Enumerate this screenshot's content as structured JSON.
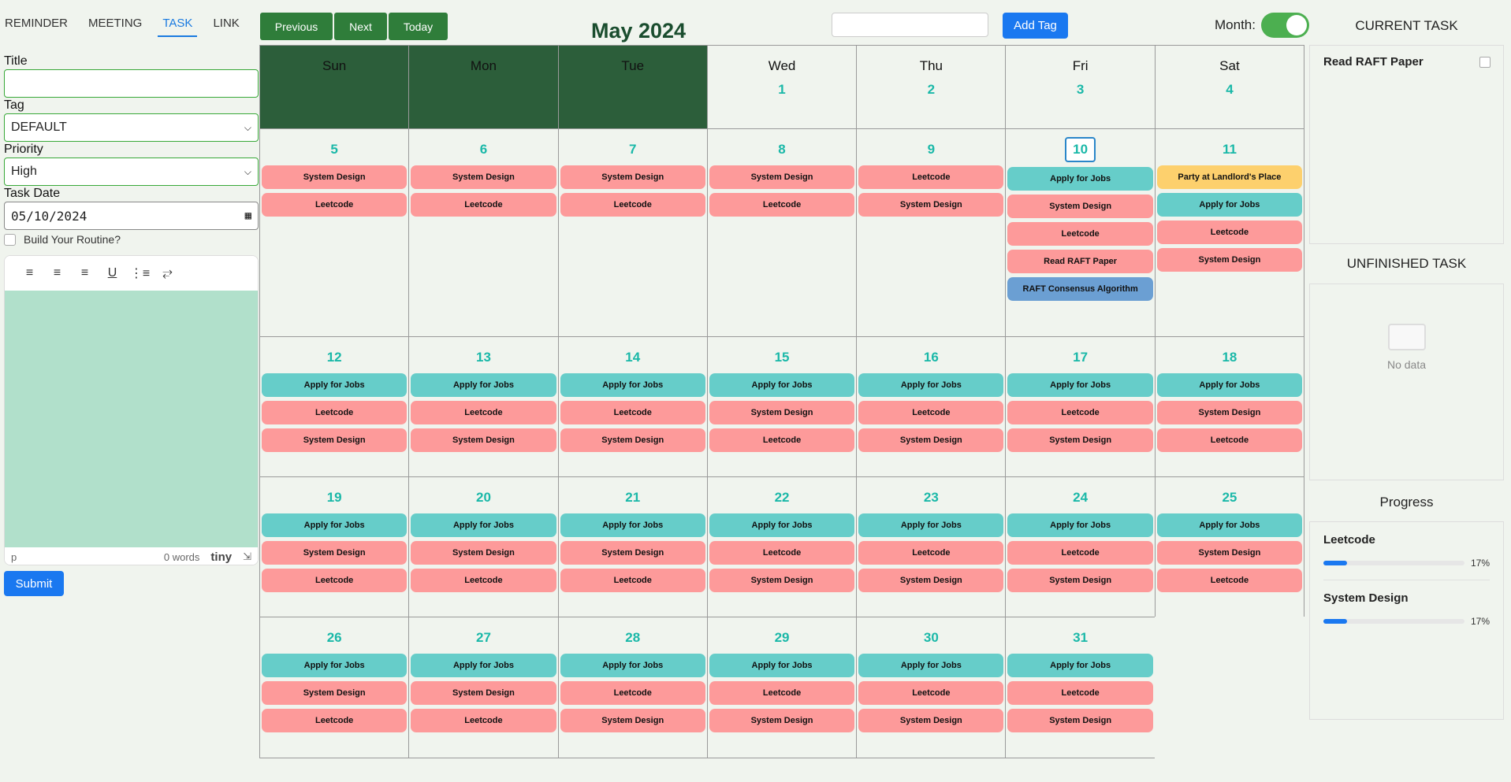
{
  "tabs": [
    "REMINDER",
    "MEETING",
    "TASK",
    "LINK"
  ],
  "active_tab": "TASK",
  "form": {
    "title_label": "Title",
    "title_value": "",
    "tag_label": "Tag",
    "tag_value": "DEFAULT",
    "priority_label": "Priority",
    "priority_value": "High",
    "date_label": "Task Date",
    "date_value": "05/10/2024",
    "routine_label": "Build Your Routine?",
    "editor_status_left": "p",
    "editor_words": "0 words",
    "editor_brand": "tiny",
    "submit_label": "Submit"
  },
  "toolbar": {
    "previous": "Previous",
    "next": "Next",
    "today": "Today",
    "month_title": "May 2024",
    "tag_input_value": "",
    "add_tag": "Add Tag",
    "month_toggle_label": "Month:"
  },
  "calendar": {
    "weekdays": [
      "Sun",
      "Mon",
      "Tue",
      "Wed",
      "Thu",
      "Fri",
      "Sat"
    ],
    "today": "10",
    "weeks": [
      [
        {
          "day": "",
          "events": []
        },
        {
          "day": "",
          "events": []
        },
        {
          "day": "",
          "events": []
        },
        {
          "day": "1",
          "events": []
        },
        {
          "day": "2",
          "events": []
        },
        {
          "day": "3",
          "events": []
        },
        {
          "day": "4",
          "events": []
        }
      ],
      [
        {
          "day": "5",
          "events": [
            [
              "System Design",
              "pink"
            ],
            [
              "Leetcode",
              "pink"
            ]
          ]
        },
        {
          "day": "6",
          "events": [
            [
              "System Design",
              "pink"
            ],
            [
              "Leetcode",
              "pink"
            ]
          ]
        },
        {
          "day": "7",
          "events": [
            [
              "System Design",
              "pink"
            ],
            [
              "Leetcode",
              "pink"
            ]
          ]
        },
        {
          "day": "8",
          "events": [
            [
              "System Design",
              "pink"
            ],
            [
              "Leetcode",
              "pink"
            ]
          ]
        },
        {
          "day": "9",
          "events": [
            [
              "Leetcode",
              "pink"
            ],
            [
              "System Design",
              "pink"
            ]
          ]
        },
        {
          "day": "10",
          "events": [
            [
              "Apply for Jobs",
              "teal"
            ],
            [
              "System Design",
              "pink"
            ],
            [
              "Leetcode",
              "pink"
            ],
            [
              "Read RAFT Paper",
              "pink"
            ],
            [
              "RAFT Consensus Algorithm",
              "blue"
            ]
          ]
        },
        {
          "day": "11",
          "events": [
            [
              "Party at Landlord's Place",
              "yellow"
            ],
            [
              "Apply for Jobs",
              "teal"
            ],
            [
              "Leetcode",
              "pink"
            ],
            [
              "System Design",
              "pink"
            ]
          ]
        }
      ],
      [
        {
          "day": "12",
          "events": [
            [
              "Apply for Jobs",
              "teal"
            ],
            [
              "Leetcode",
              "pink"
            ],
            [
              "System Design",
              "pink"
            ]
          ]
        },
        {
          "day": "13",
          "events": [
            [
              "Apply for Jobs",
              "teal"
            ],
            [
              "Leetcode",
              "pink"
            ],
            [
              "System Design",
              "pink"
            ]
          ]
        },
        {
          "day": "14",
          "events": [
            [
              "Apply for Jobs",
              "teal"
            ],
            [
              "Leetcode",
              "pink"
            ],
            [
              "System Design",
              "pink"
            ]
          ]
        },
        {
          "day": "15",
          "events": [
            [
              "Apply for Jobs",
              "teal"
            ],
            [
              "System Design",
              "pink"
            ],
            [
              "Leetcode",
              "pink"
            ]
          ]
        },
        {
          "day": "16",
          "events": [
            [
              "Apply for Jobs",
              "teal"
            ],
            [
              "Leetcode",
              "pink"
            ],
            [
              "System Design",
              "pink"
            ]
          ]
        },
        {
          "day": "17",
          "events": [
            [
              "Apply for Jobs",
              "teal"
            ],
            [
              "Leetcode",
              "pink"
            ],
            [
              "System Design",
              "pink"
            ]
          ]
        },
        {
          "day": "18",
          "events": [
            [
              "Apply for Jobs",
              "teal"
            ],
            [
              "System Design",
              "pink"
            ],
            [
              "Leetcode",
              "pink"
            ]
          ]
        }
      ],
      [
        {
          "day": "19",
          "events": [
            [
              "Apply for Jobs",
              "teal"
            ],
            [
              "System Design",
              "pink"
            ],
            [
              "Leetcode",
              "pink"
            ]
          ]
        },
        {
          "day": "20",
          "events": [
            [
              "Apply for Jobs",
              "teal"
            ],
            [
              "System Design",
              "pink"
            ],
            [
              "Leetcode",
              "pink"
            ]
          ]
        },
        {
          "day": "21",
          "events": [
            [
              "Apply for Jobs",
              "teal"
            ],
            [
              "System Design",
              "pink"
            ],
            [
              "Leetcode",
              "pink"
            ]
          ]
        },
        {
          "day": "22",
          "events": [
            [
              "Apply for Jobs",
              "teal"
            ],
            [
              "Leetcode",
              "pink"
            ],
            [
              "System Design",
              "pink"
            ]
          ]
        },
        {
          "day": "23",
          "events": [
            [
              "Apply for Jobs",
              "teal"
            ],
            [
              "Leetcode",
              "pink"
            ],
            [
              "System Design",
              "pink"
            ]
          ]
        },
        {
          "day": "24",
          "events": [
            [
              "Apply for Jobs",
              "teal"
            ],
            [
              "Leetcode",
              "pink"
            ],
            [
              "System Design",
              "pink"
            ]
          ]
        },
        {
          "day": "25",
          "events": [
            [
              "Apply for Jobs",
              "teal"
            ],
            [
              "System Design",
              "pink"
            ],
            [
              "Leetcode",
              "pink"
            ]
          ]
        }
      ],
      [
        {
          "day": "26",
          "events": [
            [
              "Apply for Jobs",
              "teal"
            ],
            [
              "System Design",
              "pink"
            ],
            [
              "Leetcode",
              "pink"
            ]
          ]
        },
        {
          "day": "27",
          "events": [
            [
              "Apply for Jobs",
              "teal"
            ],
            [
              "System Design",
              "pink"
            ],
            [
              "Leetcode",
              "pink"
            ]
          ]
        },
        {
          "day": "28",
          "events": [
            [
              "Apply for Jobs",
              "teal"
            ],
            [
              "Leetcode",
              "pink"
            ],
            [
              "System Design",
              "pink"
            ]
          ]
        },
        {
          "day": "29",
          "events": [
            [
              "Apply for Jobs",
              "teal"
            ],
            [
              "Leetcode",
              "pink"
            ],
            [
              "System Design",
              "pink"
            ]
          ]
        },
        {
          "day": "30",
          "events": [
            [
              "Apply for Jobs",
              "teal"
            ],
            [
              "Leetcode",
              "pink"
            ],
            [
              "System Design",
              "pink"
            ]
          ]
        },
        {
          "day": "31",
          "events": [
            [
              "Apply for Jobs",
              "teal"
            ],
            [
              "Leetcode",
              "pink"
            ],
            [
              "System Design",
              "pink"
            ]
          ]
        }
      ]
    ]
  },
  "right": {
    "current_task_title": "CURRENT TASK",
    "current_tasks": [
      "Read RAFT Paper"
    ],
    "unfinished_title": "UNFINISHED TASK",
    "no_data": "No data",
    "progress_title": "Progress",
    "progress": [
      {
        "name": "Leetcode",
        "percent": 17,
        "label": "17%"
      },
      {
        "name": "System Design",
        "percent": 17,
        "label": "17%"
      }
    ]
  },
  "colors": {
    "accent_blue": "#1a78f0",
    "nav_green": "#2f7d3a",
    "dark_header": "#2c5e3a",
    "day_number": "#1ab8a8",
    "teal_event": "#66cdc9",
    "pink_event": "#fd9a9a",
    "yellow_event": "#fdd06d",
    "blue_event": "#6b9fd3"
  }
}
